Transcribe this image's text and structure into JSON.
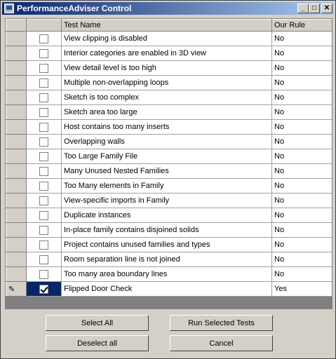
{
  "window": {
    "title": "PerformanceAdviser Control",
    "min_glyph": "_",
    "max_glyph": "□",
    "close_glyph": "✕"
  },
  "grid": {
    "columns": {
      "test_name": "Test Name",
      "our_rule": "Our Rule"
    },
    "rows": [
      {
        "name": "View clipping is disabled",
        "rule": "No",
        "checked": false
      },
      {
        "name": "Interior categories are enabled in 3D view",
        "rule": "No",
        "checked": false
      },
      {
        "name": "View detail level is too high",
        "rule": "No",
        "checked": false
      },
      {
        "name": "Multiple non-overlapping loops",
        "rule": "No",
        "checked": false
      },
      {
        "name": "Sketch is too complex",
        "rule": "No",
        "checked": false
      },
      {
        "name": "Sketch area too large",
        "rule": "No",
        "checked": false
      },
      {
        "name": "Host contains too many inserts",
        "rule": "No",
        "checked": false
      },
      {
        "name": "Overlapping walls",
        "rule": "No",
        "checked": false
      },
      {
        "name": "Too Large Family File",
        "rule": "No",
        "checked": false
      },
      {
        "name": "Many Unused Nested Families",
        "rule": "No",
        "checked": false
      },
      {
        "name": "Too Many elements in Family",
        "rule": "No",
        "checked": false
      },
      {
        "name": "View-specific imports in Family",
        "rule": "No",
        "checked": false
      },
      {
        "name": "Duplicate instances",
        "rule": "No",
        "checked": false
      },
      {
        "name": "In-place family contains disjoined solids",
        "rule": "No",
        "checked": false
      },
      {
        "name": "Project contains unused families and types",
        "rule": "No",
        "checked": false
      },
      {
        "name": "Room separation line is not joined",
        "rule": "No",
        "checked": false
      },
      {
        "name": "Too many area boundary lines",
        "rule": "No",
        "checked": false
      },
      {
        "name": "Flipped Door Check",
        "rule": "Yes",
        "checked": true,
        "editing": true
      }
    ]
  },
  "buttons": {
    "select_all": "Select All",
    "run_selected": "Run Selected Tests",
    "deselect_all": "Deselect all",
    "cancel": "Cancel"
  },
  "icons": {
    "edit_row": "pencil-icon"
  }
}
